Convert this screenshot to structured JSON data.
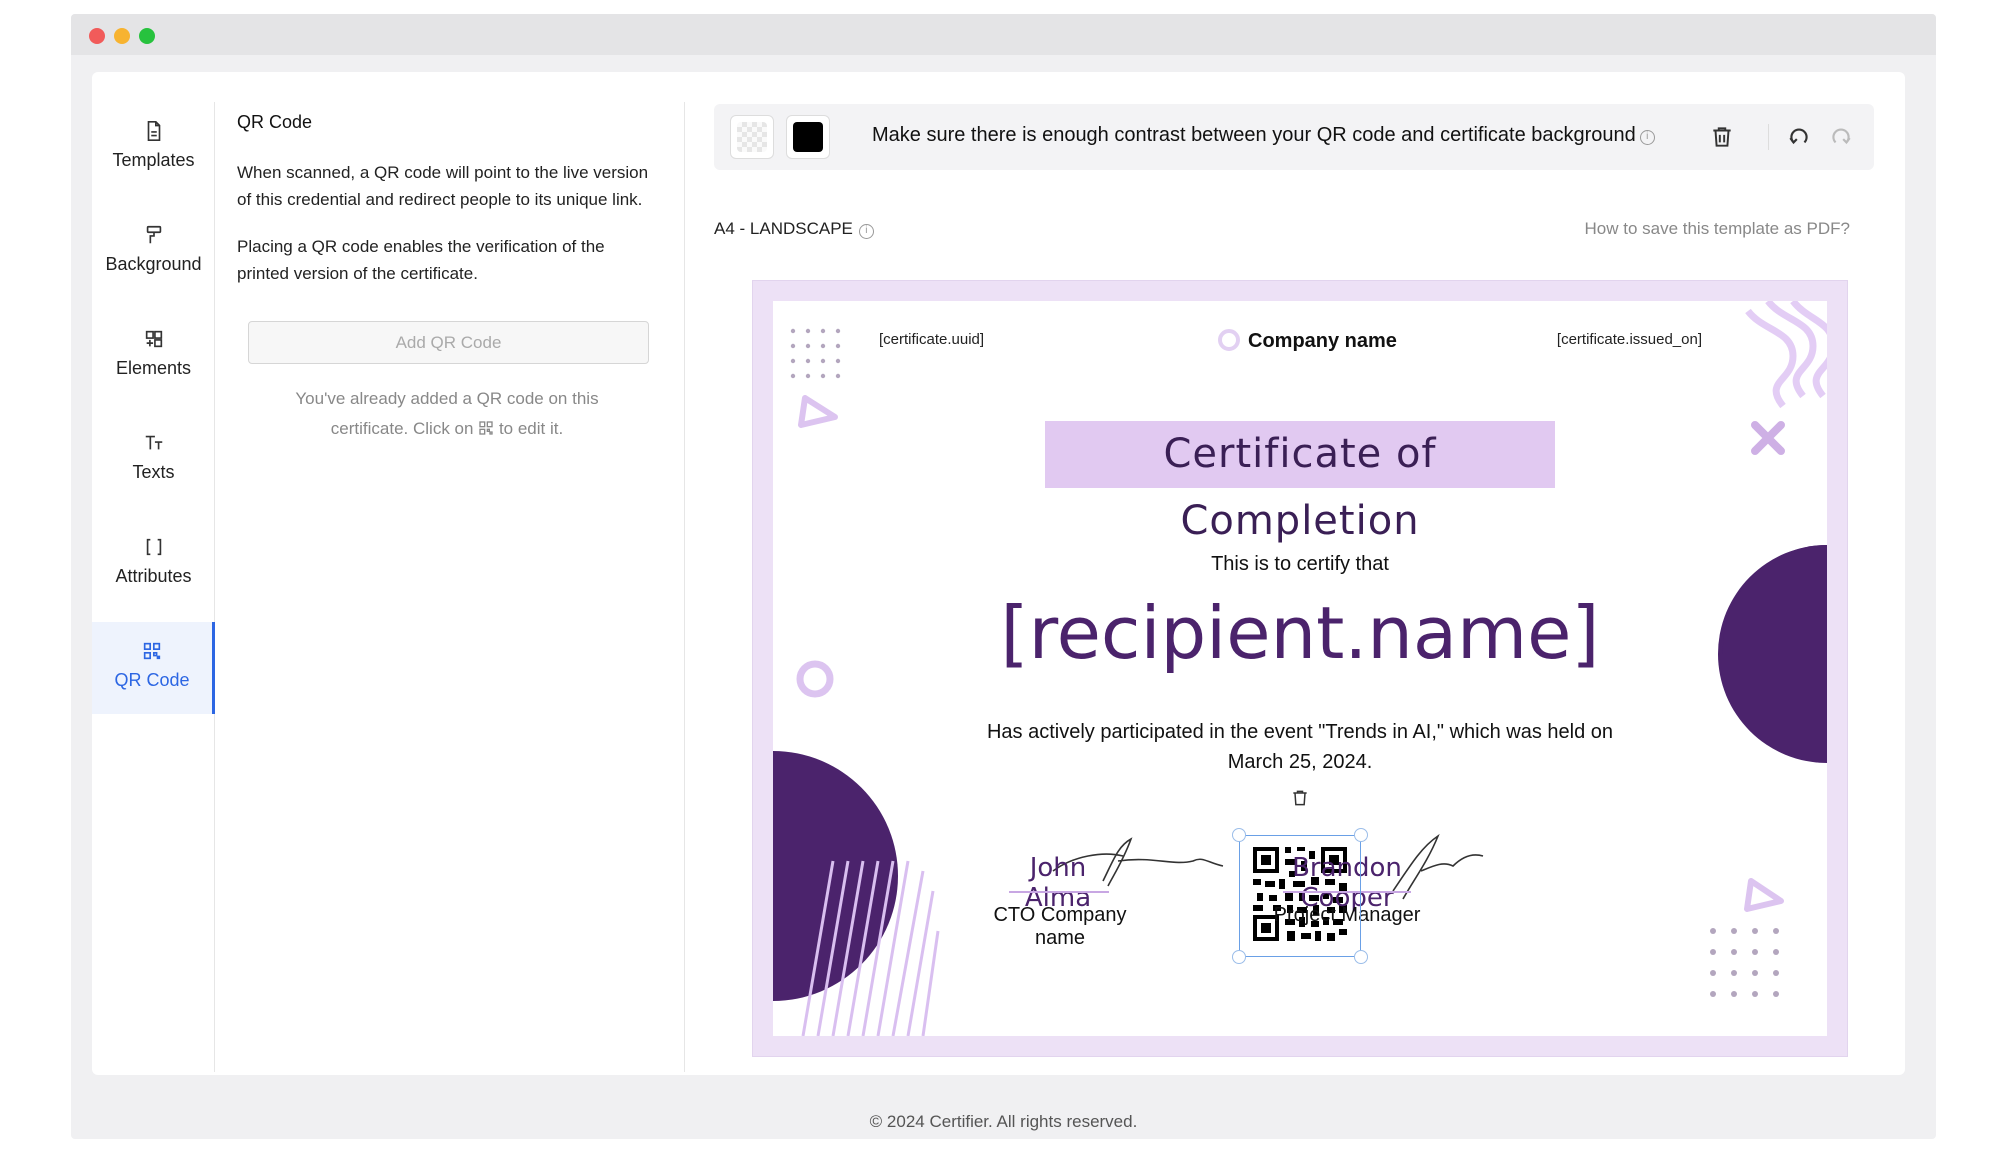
{
  "sidebar": {
    "items": [
      {
        "label": "Templates",
        "icon": "template-icon"
      },
      {
        "label": "Background",
        "icon": "paint-roller-icon"
      },
      {
        "label": "Elements",
        "icon": "elements-icon"
      },
      {
        "label": "Texts",
        "icon": "text-icon"
      },
      {
        "label": "Attributes",
        "icon": "brackets-icon"
      },
      {
        "label": "QR Code",
        "icon": "qr-code-icon",
        "active": true
      }
    ]
  },
  "panel": {
    "title": "QR Code",
    "para1": "When scanned, a QR code will point to the live version of this credential and redirect people to its unique link.",
    "para2": "Placing a QR code enables the verification of the printed version of the certificate.",
    "add_button": "Add QR Code",
    "hint_line1": "You've already added a QR code on this",
    "hint_line2_a": "certificate. Click on",
    "hint_line2_b": "to edit it."
  },
  "toolbar": {
    "message": "Make sure there is enough contrast between your QR code and certificate background",
    "qr_color": "#000000"
  },
  "canvas": {
    "size_label": "A4 - LANDSCAPE",
    "help_link": "How to save this template as PDF?"
  },
  "certificate": {
    "uuid": "[certificate.uuid]",
    "company": "Company name",
    "issued_on": "[certificate.issued_on]",
    "title": "Certificate of Completion",
    "certify": "This is to certify that",
    "recipient": "[recipient.name]",
    "description": "Has actively participated in the event \"Trends in AI,\" which was held on March 25, 2024.",
    "signer1": {
      "name": "John Alma",
      "role": "CTO Company name"
    },
    "signer2": {
      "name": "Brandon Cooper",
      "role": "Project Manager"
    },
    "accent_color": "#4b236c",
    "light_accent": "#e1c9f1"
  },
  "footer": "© 2024 Certifier. All rights reserved."
}
